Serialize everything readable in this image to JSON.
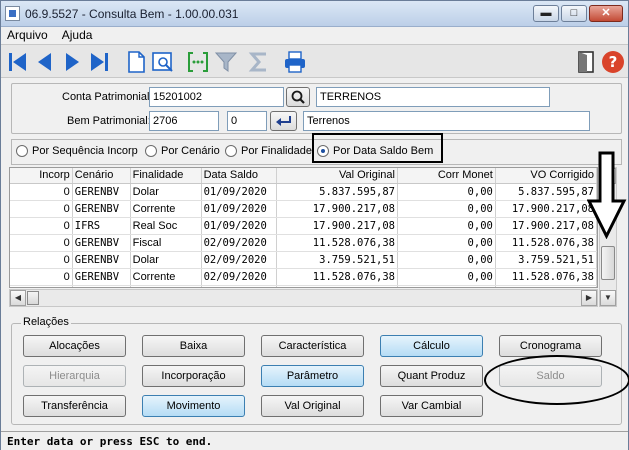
{
  "window": {
    "title": "06.9.5527 - Consulta Bem - 1.00.00.031",
    "min": "▬",
    "max": "□",
    "close": "✕"
  },
  "menu": [
    "Arquivo",
    "Ajuda"
  ],
  "form": {
    "conta_label": "Conta Patrimonial:",
    "conta_value": "15201002",
    "conta_desc": "TERRENOS",
    "bem_label": "Bem Patrimonial:",
    "bem_value": "2706",
    "bem_seq": "0",
    "bem_desc": "Terrenos"
  },
  "radios": [
    {
      "label": "Por Sequência Incorp",
      "selected": false
    },
    {
      "label": "Por Cenário",
      "selected": false
    },
    {
      "label": "Por Finalidade",
      "selected": false
    },
    {
      "label": "Por Data Saldo Bem",
      "selected": true
    }
  ],
  "table": {
    "columns": [
      "Incorp",
      "Cenário",
      "Finalidade",
      "Data Saldo",
      "Val Original",
      "Corr Monet",
      "VO Corrigido"
    ],
    "rows": [
      [
        "0",
        "GERENBV",
        "Dolar",
        "01/09/2020",
        "5.837.595,87",
        "0,00",
        "5.837.595,87"
      ],
      [
        "0",
        "GERENBV",
        "Corrente",
        "01/09/2020",
        "17.900.217,08",
        "0,00",
        "17.900.217,08"
      ],
      [
        "0",
        "IFRS",
        "Real Soc",
        "01/09/2020",
        "17.900.217,08",
        "0,00",
        "17.900.217,08"
      ],
      [
        "0",
        "GERENBV",
        "Fiscal",
        "02/09/2020",
        "11.528.076,38",
        "0,00",
        "11.528.076,38"
      ],
      [
        "0",
        "GERENBV",
        "Dolar",
        "02/09/2020",
        "3.759.521,51",
        "0,00",
        "3.759.521,51"
      ],
      [
        "0",
        "GERENBV",
        "Corrente",
        "02/09/2020",
        "11.528.076,38",
        "0,00",
        "11.528.076,38"
      ]
    ]
  },
  "relacoes": {
    "title": "Relações",
    "buttons": [
      {
        "label": "Alocações",
        "style": "normal"
      },
      {
        "label": "Baixa",
        "style": "normal"
      },
      {
        "label": "Característica",
        "style": "normal"
      },
      {
        "label": "Cálculo",
        "style": "blue"
      },
      {
        "label": "Cronograma",
        "style": "normal"
      },
      {
        "label": "Hierarquia",
        "style": "disabled"
      },
      {
        "label": "Incorporação",
        "style": "normal"
      },
      {
        "label": "Parâmetro",
        "style": "blue"
      },
      {
        "label": "Quant Produz",
        "style": "normal"
      },
      {
        "label": "Saldo",
        "style": "disabled"
      },
      {
        "label": "Transferência",
        "style": "normal"
      },
      {
        "label": "Movimento",
        "style": "blue"
      },
      {
        "label": "Val Original",
        "style": "normal"
      },
      {
        "label": "Var Cambial",
        "style": "normal"
      }
    ]
  },
  "status": "Enter data or press ESC to end.",
  "icons": [
    "first-icon",
    "prev-icon",
    "next-icon",
    "last-icon",
    "new-doc-icon",
    "preview-icon",
    "goto-icon",
    "filter-icon",
    "sum-icon",
    "print-icon",
    "exit-icon",
    "help-icon"
  ],
  "colors": {
    "accent": "#1f64c8",
    "selected_button": "#b5dcf5",
    "help": "#d9432a"
  }
}
